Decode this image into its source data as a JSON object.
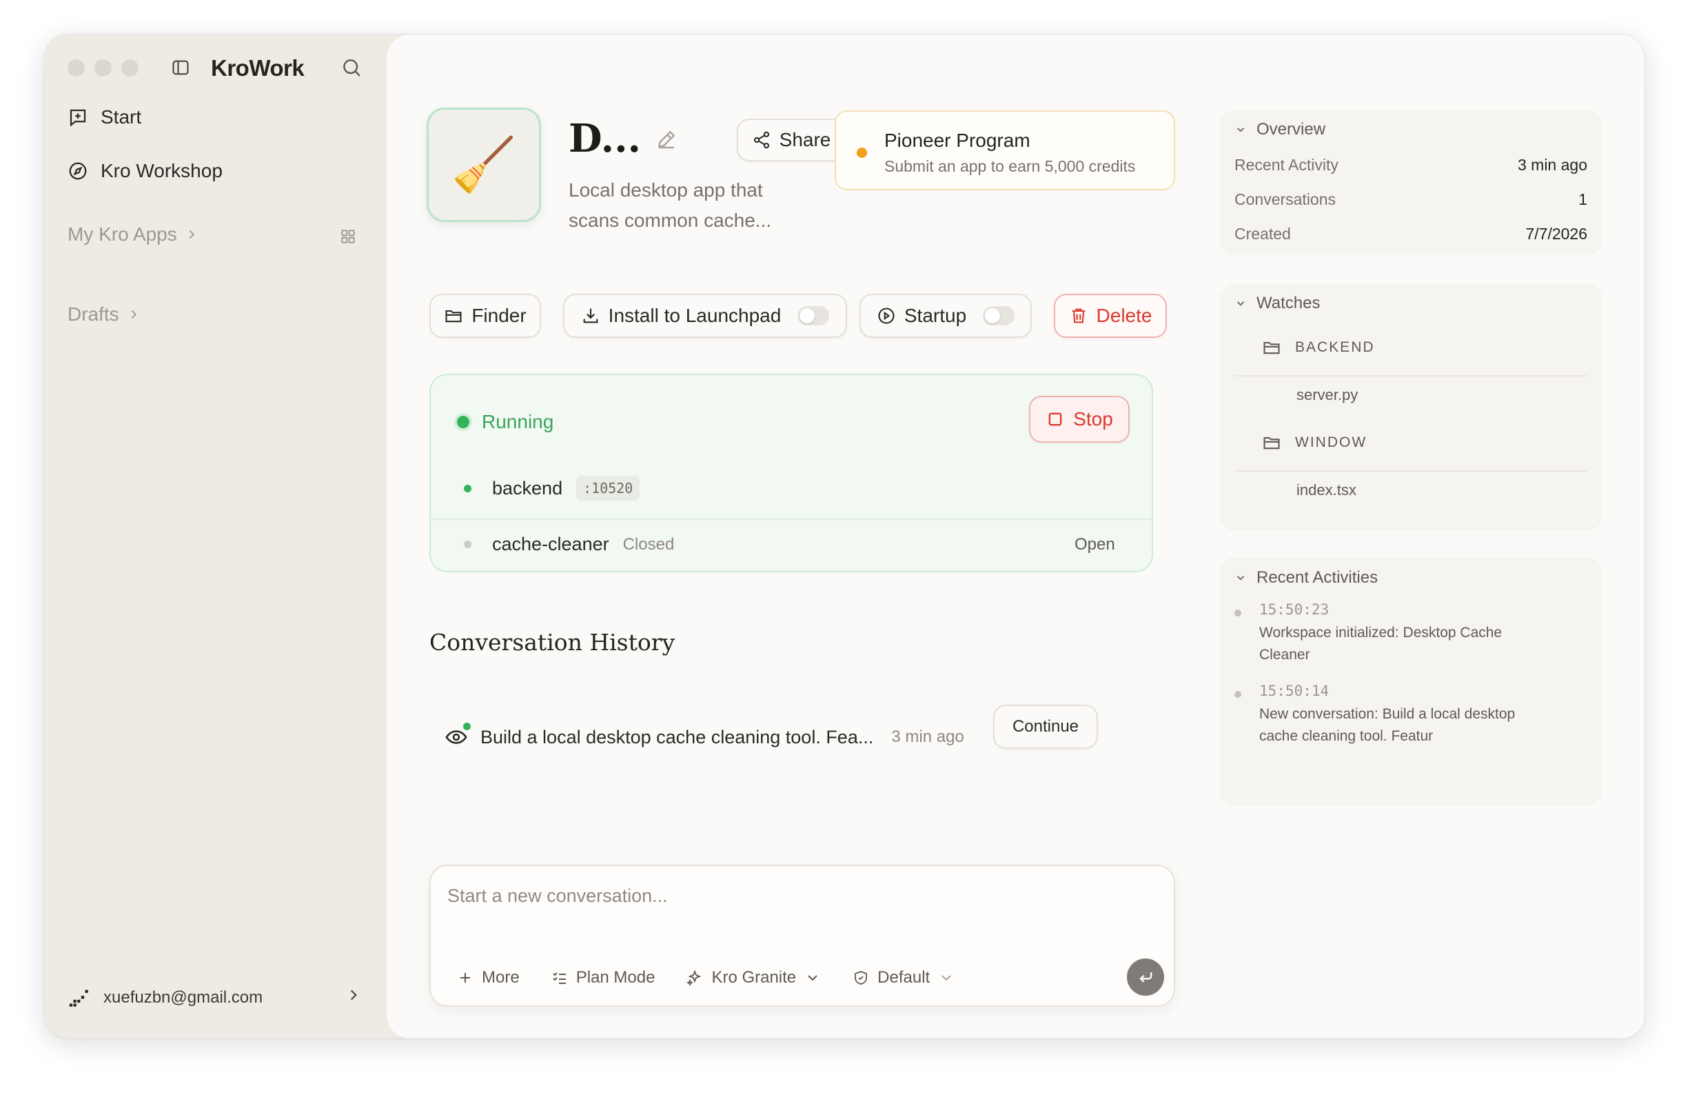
{
  "sidebar": {
    "brand": "KroWork",
    "nav": [
      {
        "label": "Start",
        "icon": "new-chat-icon"
      },
      {
        "label": "Kro Workshop",
        "icon": "compass-icon"
      }
    ],
    "my_apps_label": "My Kro Apps",
    "drafts_label": "Drafts",
    "user_email": "xuefuzbn@gmail.com"
  },
  "app": {
    "icon_glyph": "🧹",
    "title": "D...",
    "description": "Local desktop app that scans common cache...",
    "share_label": "Share"
  },
  "pioneer": {
    "title": "Pioneer Program",
    "subtitle": "Submit an app to earn 5,000 credits",
    "accent": "#f0a01c"
  },
  "actions": {
    "finder_label": "Finder",
    "install_label": "Install to Launchpad",
    "install_enabled": false,
    "startup_label": "Startup",
    "startup_enabled": false,
    "delete_label": "Delete"
  },
  "status": {
    "label": "Running",
    "color": "#34b35a",
    "stop_label": "Stop",
    "services": [
      {
        "name": "backend",
        "port": ":10520",
        "state": "running"
      },
      {
        "name": "cache-cleaner",
        "state_label": "Closed",
        "action_label": "Open"
      }
    ]
  },
  "history": {
    "title": "Conversation History",
    "items": [
      {
        "title": "Build a local desktop cache cleaning tool. Fea...",
        "time": "3 min ago",
        "action_label": "Continue"
      }
    ]
  },
  "composer": {
    "placeholder": "Start a new conversation...",
    "more_label": "More",
    "plan_label": "Plan Mode",
    "model_label": "Kro Granite",
    "permission_label": "Default"
  },
  "overview": {
    "title": "Overview",
    "rows": [
      {
        "key": "Recent Activity",
        "value": "3 min ago"
      },
      {
        "key": "Conversations",
        "value": "1"
      },
      {
        "key": "Created",
        "value": "7/7/2026"
      }
    ]
  },
  "watches": {
    "title": "Watches",
    "groups": [
      {
        "folder": "BACKEND",
        "file": "server.py"
      },
      {
        "folder": "WINDOW",
        "file": "index.tsx"
      }
    ]
  },
  "activities": {
    "title": "Recent Activities",
    "items": [
      {
        "time": "15:50:23",
        "text": "Workspace initialized: Desktop Cache Cleaner"
      },
      {
        "time": "15:50:14",
        "text": "New conversation: Build a local desktop cache cleaning tool. Featur"
      }
    ]
  }
}
